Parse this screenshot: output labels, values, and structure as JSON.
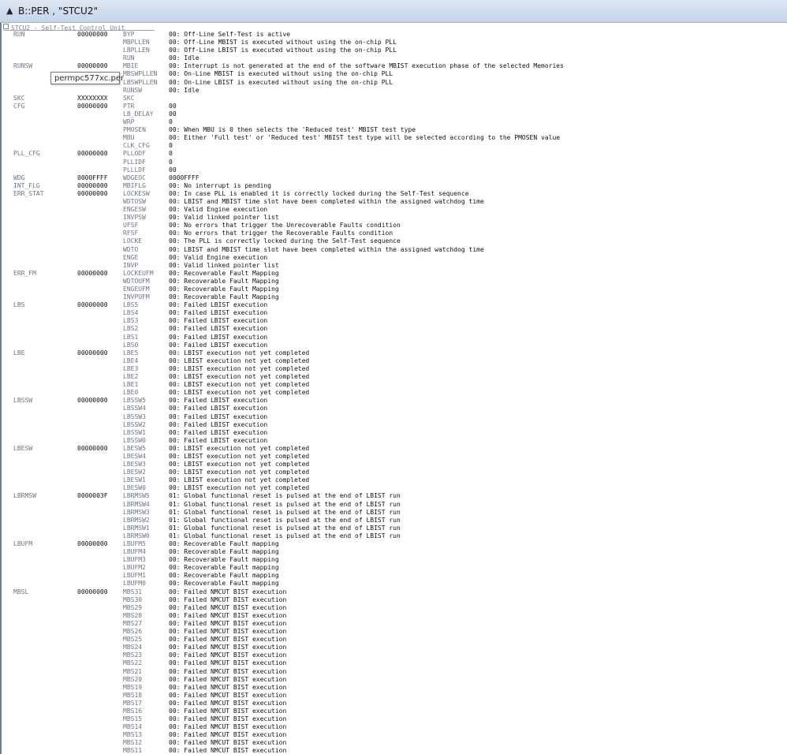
{
  "window": {
    "title": "B::PER , \"STCU2\"",
    "icon": "tree-icon"
  },
  "tooltip": "permpc577xc.per",
  "section": {
    "label": "STCU2 - Self-Test Control Unit",
    "toggle": "collapse-box-icon"
  },
  "rows": [
    {
      "reg": "RUN",
      "val": "00000000",
      "field": "BYP",
      "desc": "00: Off-Line Self-Test is active"
    },
    {
      "reg": "",
      "val": "",
      "field": "MBPLLEN",
      "desc": "00: Off-Line MBIST is executed without using the on-chip PLL"
    },
    {
      "reg": "",
      "val": "",
      "field": "LBPLLEN",
      "desc": "00: Off-Line LBIST is executed without using the on-chip PLL"
    },
    {
      "reg": "",
      "val": "",
      "field": "RUN",
      "desc": "00: Idle"
    },
    {
      "reg": "RUNSW",
      "val": "00000000",
      "field": "MBIE",
      "desc": "00: Interrupt is not generated at the end of the software MBIST execution phase of the selected Memories"
    },
    {
      "reg": "",
      "val": "",
      "field": "MBSWPLLEN",
      "desc": "00: On-Line MBIST is executed without using the on-chip PLL"
    },
    {
      "reg": "",
      "val": "",
      "field": "LBSWPLLEN",
      "desc": "00: On-Line LBIST is executed without using the on-chip PLL"
    },
    {
      "reg": "",
      "val": "",
      "field": "RUNSW",
      "desc": "00: Idle"
    },
    {
      "reg": "SKC",
      "val": "XXXXXXXX",
      "field": "SKC",
      "desc": ""
    },
    {
      "reg": "CFG",
      "val": "00000000",
      "field": "PTR",
      "desc": "00"
    },
    {
      "reg": "",
      "val": "",
      "field": "LB_DELAY",
      "desc": "00"
    },
    {
      "reg": "",
      "val": "",
      "field": "WRP",
      "desc": "0"
    },
    {
      "reg": "",
      "val": "",
      "field": "PMOSEN",
      "desc": "00: When MBU is 0 then selects the 'Reduced test' MBIST test type"
    },
    {
      "reg": "",
      "val": "",
      "field": "MBU",
      "desc": "00: Either 'Full test' or 'Reduced test' MBIST test type will be selected according to the PMOSEN value"
    },
    {
      "reg": "",
      "val": "",
      "field": "CLK_CFG",
      "desc": "0"
    },
    {
      "reg": "PLL_CFG",
      "val": "00000000",
      "field": "PLLODF",
      "desc": "0"
    },
    {
      "reg": "",
      "val": "",
      "field": "PLLIDF",
      "desc": "0"
    },
    {
      "reg": "",
      "val": "",
      "field": "PLLLDF",
      "desc": "00"
    },
    {
      "reg": "WDG",
      "val": "0000FFFF",
      "field": "WDGEOC",
      "desc": "0000FFFF"
    },
    {
      "reg": "INT_FLG",
      "val": "00000000",
      "field": "MBIFLG",
      "desc": "00: No interrupt is pending"
    },
    {
      "reg": "ERR_STAT",
      "val": "00000000",
      "field": "LOCKESW",
      "desc": "00: In case PLL is enabled it is correctly locked during the Self-Test sequence"
    },
    {
      "reg": "",
      "val": "",
      "field": "WDTOSW",
      "desc": "00: LBIST and MBIST time slot have been completed within the assigned watchdog time"
    },
    {
      "reg": "",
      "val": "",
      "field": "ENGESW",
      "desc": "00: Valid Engine execution"
    },
    {
      "reg": "",
      "val": "",
      "field": "INVPSW",
      "desc": "00: Valid linked pointer list"
    },
    {
      "reg": "",
      "val": "",
      "field": "UFSF",
      "desc": "00: No errors that trigger the Unrecoverable Faults condition"
    },
    {
      "reg": "",
      "val": "",
      "field": "RFSF",
      "desc": "00: No errors that trigger the Recoverable Faults condition"
    },
    {
      "reg": "",
      "val": "",
      "field": "LOCKE",
      "desc": "00: The PLL is correctly locked during the Self-Test sequence"
    },
    {
      "reg": "",
      "val": "",
      "field": "WDTO",
      "desc": "00: LBIST and MBIST time slot have been completed within the assigned watchdog time"
    },
    {
      "reg": "",
      "val": "",
      "field": "ENGE",
      "desc": "00: Valid Engine execution"
    },
    {
      "reg": "",
      "val": "",
      "field": "INVP",
      "desc": "00: Valid linked pointer list"
    },
    {
      "reg": "ERR_FM",
      "val": "00000000",
      "field": "LOCKEUFM",
      "desc": "00: Recoverable Fault Mapping"
    },
    {
      "reg": "",
      "val": "",
      "field": "WDTOUFM",
      "desc": "00: Recoverable Fault Mapping"
    },
    {
      "reg": "",
      "val": "",
      "field": "ENGEUFM",
      "desc": "00: Recoverable Fault Mapping"
    },
    {
      "reg": "",
      "val": "",
      "field": "INVPUFM",
      "desc": "00: Recoverable Fault Mapping"
    },
    {
      "reg": "LBS",
      "val": "00000000",
      "field": "LBS5",
      "desc": "00: Failed LBIST execution"
    },
    {
      "reg": "",
      "val": "",
      "field": "LBS4",
      "desc": "00: Failed LBIST execution"
    },
    {
      "reg": "",
      "val": "",
      "field": "LBS3",
      "desc": "00: Failed LBIST execution"
    },
    {
      "reg": "",
      "val": "",
      "field": "LBS2",
      "desc": "00: Failed LBIST execution"
    },
    {
      "reg": "",
      "val": "",
      "field": "LBS1",
      "desc": "00: Failed LBIST execution"
    },
    {
      "reg": "",
      "val": "",
      "field": "LBS0",
      "desc": "00: Failed LBIST execution"
    },
    {
      "reg": "LBE",
      "val": "00000000",
      "field": "LBE5",
      "desc": "00: LBIST execution not yet completed"
    },
    {
      "reg": "",
      "val": "",
      "field": "LBE4",
      "desc": "00: LBIST execution not yet completed"
    },
    {
      "reg": "",
      "val": "",
      "field": "LBE3",
      "desc": "00: LBIST execution not yet completed"
    },
    {
      "reg": "",
      "val": "",
      "field": "LBE2",
      "desc": "00: LBIST execution not yet completed"
    },
    {
      "reg": "",
      "val": "",
      "field": "LBE1",
      "desc": "00: LBIST execution not yet completed"
    },
    {
      "reg": "",
      "val": "",
      "field": "LBE0",
      "desc": "00: LBIST execution not yet completed"
    },
    {
      "reg": "LBSSW",
      "val": "00000000",
      "field": "LBSSW5",
      "desc": "00: Failed LBIST execution"
    },
    {
      "reg": "",
      "val": "",
      "field": "LBSSW4",
      "desc": "00: Failed LBIST execution"
    },
    {
      "reg": "",
      "val": "",
      "field": "LBSSW3",
      "desc": "00: Failed LBIST execution"
    },
    {
      "reg": "",
      "val": "",
      "field": "LBSSW2",
      "desc": "00: Failed LBIST execution"
    },
    {
      "reg": "",
      "val": "",
      "field": "LBSSW1",
      "desc": "00: Failed LBIST execution"
    },
    {
      "reg": "",
      "val": "",
      "field": "LBSSW0",
      "desc": "00: Failed LBIST execution"
    },
    {
      "reg": "LBESW",
      "val": "00000000",
      "field": "LBESW5",
      "desc": "00: LBIST execution not yet completed"
    },
    {
      "reg": "",
      "val": "",
      "field": "LBESW4",
      "desc": "00: LBIST execution not yet completed"
    },
    {
      "reg": "",
      "val": "",
      "field": "LBESW3",
      "desc": "00: LBIST execution not yet completed"
    },
    {
      "reg": "",
      "val": "",
      "field": "LBESW2",
      "desc": "00: LBIST execution not yet completed"
    },
    {
      "reg": "",
      "val": "",
      "field": "LBESW1",
      "desc": "00: LBIST execution not yet completed"
    },
    {
      "reg": "",
      "val": "",
      "field": "LBESW0",
      "desc": "00: LBIST execution not yet completed"
    },
    {
      "reg": "LBRMSW",
      "val": "0000003F",
      "field": "LBRMSW5",
      "desc": "01: Global functional reset is pulsed at the end of LBIST run"
    },
    {
      "reg": "",
      "val": "",
      "field": "LBRMSW4",
      "desc": "01: Global functional reset is pulsed at the end of LBIST run"
    },
    {
      "reg": "",
      "val": "",
      "field": "LBRMSW3",
      "desc": "01: Global functional reset is pulsed at the end of LBIST run"
    },
    {
      "reg": "",
      "val": "",
      "field": "LBRMSW2",
      "desc": "01: Global functional reset is pulsed at the end of LBIST run"
    },
    {
      "reg": "",
      "val": "",
      "field": "LBRMSW1",
      "desc": "01: Global functional reset is pulsed at the end of LBIST run"
    },
    {
      "reg": "",
      "val": "",
      "field": "LBRMSW0",
      "desc": "01: Global functional reset is pulsed at the end of LBIST run"
    },
    {
      "reg": "LBUFM",
      "val": "00000000",
      "field": "LBUFM5",
      "desc": "00: Recoverable Fault mapping"
    },
    {
      "reg": "",
      "val": "",
      "field": "LBUFM4",
      "desc": "00: Recoverable Fault mapping"
    },
    {
      "reg": "",
      "val": "",
      "field": "LBUFM3",
      "desc": "00: Recoverable Fault mapping"
    },
    {
      "reg": "",
      "val": "",
      "field": "LBUFM2",
      "desc": "00: Recoverable Fault mapping"
    },
    {
      "reg": "",
      "val": "",
      "field": "LBUFM1",
      "desc": "00: Recoverable Fault mapping"
    },
    {
      "reg": "",
      "val": "",
      "field": "LBUFM0",
      "desc": "00: Recoverable Fault mapping"
    },
    {
      "reg": "MBSL",
      "val": "00000000",
      "field": "MBS31",
      "desc": "00: Failed NMCUT BIST execution"
    },
    {
      "reg": "",
      "val": "",
      "field": "MBS30",
      "desc": "00: Failed NMCUT BIST execution"
    },
    {
      "reg": "",
      "val": "",
      "field": "MBS29",
      "desc": "00: Failed NMCUT BIST execution"
    },
    {
      "reg": "",
      "val": "",
      "field": "MBS28",
      "desc": "00: Failed NMCUT BIST execution"
    },
    {
      "reg": "",
      "val": "",
      "field": "MBS27",
      "desc": "00: Failed NMCUT BIST execution"
    },
    {
      "reg": "",
      "val": "",
      "field": "MBS26",
      "desc": "00: Failed NMCUT BIST execution"
    },
    {
      "reg": "",
      "val": "",
      "field": "MBS25",
      "desc": "00: Failed NMCUT BIST execution"
    },
    {
      "reg": "",
      "val": "",
      "field": "MBS24",
      "desc": "00: Failed NMCUT BIST execution"
    },
    {
      "reg": "",
      "val": "",
      "field": "MBS23",
      "desc": "00: Failed NMCUT BIST execution"
    },
    {
      "reg": "",
      "val": "",
      "field": "MBS22",
      "desc": "00: Failed NMCUT BIST execution"
    },
    {
      "reg": "",
      "val": "",
      "field": "MBS21",
      "desc": "00: Failed NMCUT BIST execution"
    },
    {
      "reg": "",
      "val": "",
      "field": "MBS20",
      "desc": "00: Failed NMCUT BIST execution"
    },
    {
      "reg": "",
      "val": "",
      "field": "MBS19",
      "desc": "00: Failed NMCUT BIST execution"
    },
    {
      "reg": "",
      "val": "",
      "field": "MBS18",
      "desc": "00: Failed NMCUT BIST execution"
    },
    {
      "reg": "",
      "val": "",
      "field": "MBS17",
      "desc": "00: Failed NMCUT BIST execution"
    },
    {
      "reg": "",
      "val": "",
      "field": "MBS16",
      "desc": "00: Failed NMCUT BIST execution"
    },
    {
      "reg": "",
      "val": "",
      "field": "MBS15",
      "desc": "00: Failed NMCUT BIST execution"
    },
    {
      "reg": "",
      "val": "",
      "field": "MBS14",
      "desc": "00: Failed NMCUT BIST execution"
    },
    {
      "reg": "",
      "val": "",
      "field": "MBS13",
      "desc": "00: Failed NMCUT BIST execution"
    },
    {
      "reg": "",
      "val": "",
      "field": "MBS12",
      "desc": "00: Failed NMCUT BIST execution"
    },
    {
      "reg": "",
      "val": "",
      "field": "MBS11",
      "desc": "00: Failed NMCUT BIST execution"
    }
  ]
}
